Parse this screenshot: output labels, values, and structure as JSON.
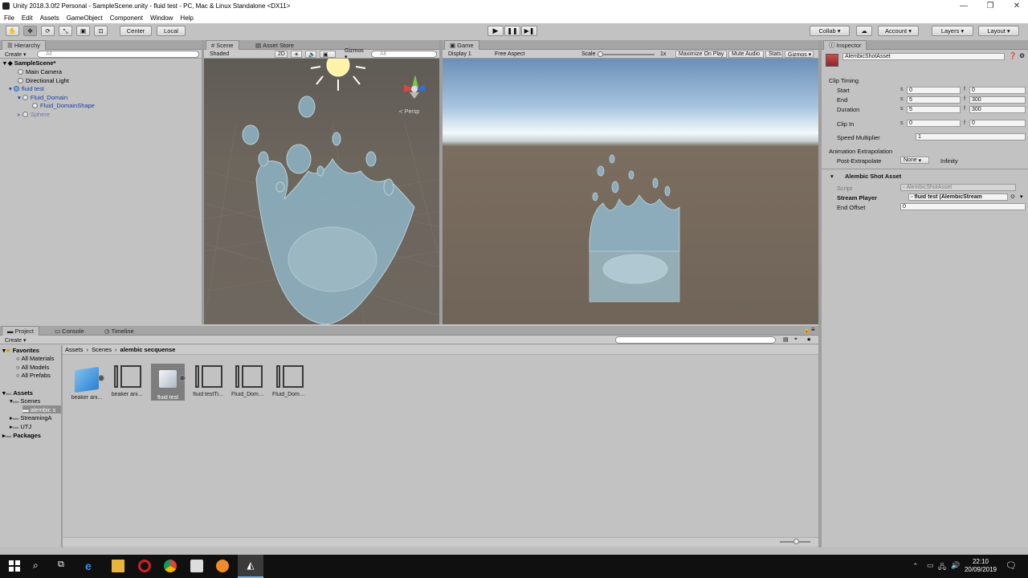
{
  "window": {
    "title": "Unity 2018.3.0f2 Personal - SampleScene.unity - fluid test - PC, Mac & Linux Standalone <DX11>",
    "minimize": "—",
    "maximize": "❐",
    "close": "✕"
  },
  "menu": [
    "File",
    "Edit",
    "Assets",
    "GameObject",
    "Component",
    "Window",
    "Help"
  ],
  "toolbar": {
    "center": "Center",
    "local": "Local",
    "collab": "Collab ▾",
    "account": "Account ▾",
    "layers": "Layers ▾",
    "layout": "Layout ▾"
  },
  "hierarchy": {
    "tab": "Hierarchy",
    "create": "Create ▾",
    "search": "All",
    "scene": "SampleScene*",
    "items": [
      "Main Camera",
      "Directional Light",
      "fluid test",
      "Fluid_Domain",
      "Fluid_DomainShape",
      "Sphere"
    ]
  },
  "scene": {
    "tab": "Scene",
    "tab2": "Asset Store",
    "shading": "Shaded",
    "mode2d": "2D",
    "gizmos": "Gizmos ▾",
    "search": "All",
    "persp": "≺ Persp"
  },
  "game": {
    "tab": "Game",
    "display": "Display 1",
    "aspect": "Free Aspect",
    "scale_label": "Scale",
    "scale_value": "1x",
    "maximize": "Maximize On Play",
    "mute": "Mute Audio",
    "stats": "Stats",
    "gizmos": "Gizmos ▾"
  },
  "inspector": {
    "tab": "Inspector",
    "object_name": "AlembicShotAsset",
    "clip_timing": "Clip Timing",
    "rows": [
      {
        "label": "Start",
        "s": "0",
        "f": "0"
      },
      {
        "label": "End",
        "s": "5",
        "f": "300"
      },
      {
        "label": "Duration",
        "s": "5",
        "f": "300"
      }
    ],
    "clip_in_label": "Clip In",
    "clip_in_s": "0",
    "clip_in_f": "0",
    "s_unit": "s",
    "f_unit": "f",
    "speed_label": "Speed Multiplier",
    "speed_value": "1",
    "extrap_header": "Animation Extrapolation",
    "post_label": "Post-Extrapolate",
    "post_value": "None",
    "post_after": "Infinity",
    "component": "Alembic Shot Asset",
    "script_label": "Script",
    "script_value": "AlembicShotAsset",
    "stream_label": "Stream Player",
    "stream_value": "fluid test (AlembicStream",
    "endoffset_label": "End Offset",
    "endoffset_value": "0"
  },
  "project": {
    "tabs": [
      "Project",
      "Console",
      "Timeline"
    ],
    "create": "Create ▾",
    "breadcrumb": [
      "Assets",
      "Scenes",
      "alembic secquense"
    ],
    "favorites_label": "Favorites",
    "favorites": [
      "All Materials",
      "All Models",
      "All Prefabs"
    ],
    "assets_label": "Assets",
    "tree": [
      "Scenes",
      "alembic s",
      "StreamingA",
      "UTJ"
    ],
    "packages": "Packages",
    "items": [
      "beaker ani...",
      "beaker ani...",
      "fluid test",
      "fluid testTi...",
      "Fluid_Doma...",
      "Fluid_Doma..."
    ]
  },
  "taskbar": {
    "time": "22:10",
    "date": "20/09/2019"
  }
}
